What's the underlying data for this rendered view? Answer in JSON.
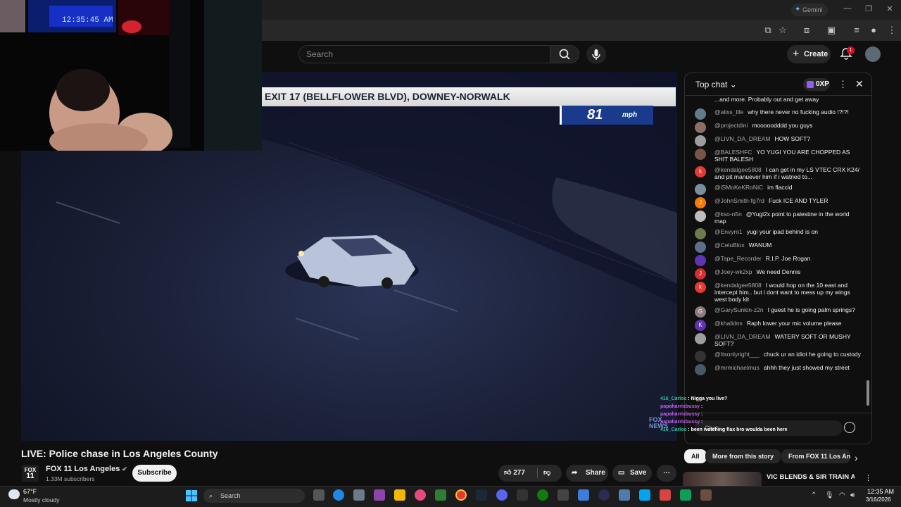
{
  "browser": {
    "gemini_label": "Gemini"
  },
  "header": {
    "search_placeholder": "Search",
    "create_label": "Create",
    "notifications_count": "1"
  },
  "video": {
    "banner_text": "EXIT 17 (BELLFLOWER BLVD), DOWNEY-NORWALK",
    "speed_value": "81",
    "speed_unit": "mph",
    "webcam_clock": "12:35:45 AM",
    "title": "LIVE: Police chase in Los Angeles County"
  },
  "channel": {
    "name": "FOX 11 Los Angeles",
    "subscribers": "1.33M subscribers",
    "logo_line1": "FOX",
    "logo_line2": "11",
    "subscribe_label": "Subscribe"
  },
  "actions": {
    "likes": "277",
    "share_label": "Share",
    "save_label": "Save"
  },
  "chat": {
    "header_label": "Top chat",
    "xp_label": "0XP",
    "input_placeholder": "Chat...",
    "partial_top": "...and more. Probably out and get away",
    "messages": [
      {
        "author": "@alixs_life",
        "text": "why there never no fucking audio !?!?!",
        "initial": "",
        "color": "#607d8b"
      },
      {
        "author": "@projectdini",
        "text": "mooooodddd you guys",
        "initial": "",
        "color": "#8d6e63"
      },
      {
        "author": "@LIVN_DA_DREAM",
        "text": "HOW SOFT?",
        "initial": "",
        "color": "#9e9e9e"
      },
      {
        "author": "@BALESHFC",
        "text": "YO YUGI YOU ARE CHOPPED AS SHIT BALESH",
        "initial": "",
        "color": "#795548"
      },
      {
        "author": "@kendalgee5808",
        "text": "I can get in my LS VTEC CRX K24/ and pit manuever him if i watned to...",
        "initial": "k",
        "color": "#e53935"
      },
      {
        "author": "@iSMoKeKRoNiC",
        "text": "im flaccid",
        "initial": "",
        "color": "#78909c"
      },
      {
        "author": "@JohnSmith-fg7rd",
        "text": "Fuck ICE AND TYLER",
        "initial": "J",
        "color": "#f57c00"
      },
      {
        "author": "@kso-n5n",
        "text": "@Yugi2x point to palestine in the world map",
        "initial": "",
        "color": "#bdbdbd"
      },
      {
        "author": "@Envyro1",
        "text": "yugi your ipad behind is on",
        "initial": "",
        "color": "#6d7a4c"
      },
      {
        "author": "@CeluBlox",
        "text": "WANUM",
        "initial": "",
        "color": "#5d6d8c"
      },
      {
        "author": "@Tape_Recorder",
        "text": "R.I.P. Joe Rogan",
        "initial": "",
        "color": "#5e35b1"
      },
      {
        "author": "@Joey-wk2xp",
        "text": "We need Dennis",
        "initial": "J",
        "color": "#d32f2f"
      },
      {
        "author": "@kendalgee5808",
        "text": "I would hop on the 10 east and intercept him.. but i dont want to mess up my wings west body kit",
        "initial": "k",
        "color": "#e53935"
      },
      {
        "author": "@GarySunkin-z2n",
        "text": "I guest he is going palm springs?",
        "initial": "G",
        "color": "#8d7b7b"
      },
      {
        "author": "@khalidns",
        "text": "Raph lower your mic volume please",
        "initial": "K",
        "color": "#5e35b1"
      },
      {
        "author": "@LIVN_DA_DREAM",
        "text": "WATERY SOFT OR MUSHY SOFT?",
        "initial": "",
        "color": "#9e9e9e"
      },
      {
        "author": "@Itsonlyright___",
        "text": "chuck ur an idiot he going to custody",
        "initial": "",
        "color": "#333333"
      },
      {
        "author": "@mrmichaelmus",
        "text": "ahhh they just showed my street",
        "initial": "",
        "color": "#455a64"
      }
    ]
  },
  "overlay_chat": [
    {
      "name": "416_Carlos",
      "text": "Nigga you live?",
      "style": "n1"
    },
    {
      "name": "papaharrisbussy",
      "text": "",
      "style": "n2"
    },
    {
      "name": "papaharrisbussy",
      "text": "",
      "style": "n2"
    },
    {
      "name": "papaharrisbussy",
      "text": "",
      "style": "n2"
    },
    {
      "name": "416_Carlos",
      "text": "been watching flax bro woulda been here",
      "style": "n1"
    }
  ],
  "recommendations": {
    "chips": [
      "All",
      "More from this story",
      "From FOX 11 Los An"
    ],
    "first_title": "VIC BLENDS & SIR TRAIN AT"
  },
  "taskbar": {
    "temperature": "67°F",
    "weather": "Mostly cloudy",
    "search_placeholder": "Search",
    "time": "12:35 AM",
    "date": "3/16/2026"
  }
}
